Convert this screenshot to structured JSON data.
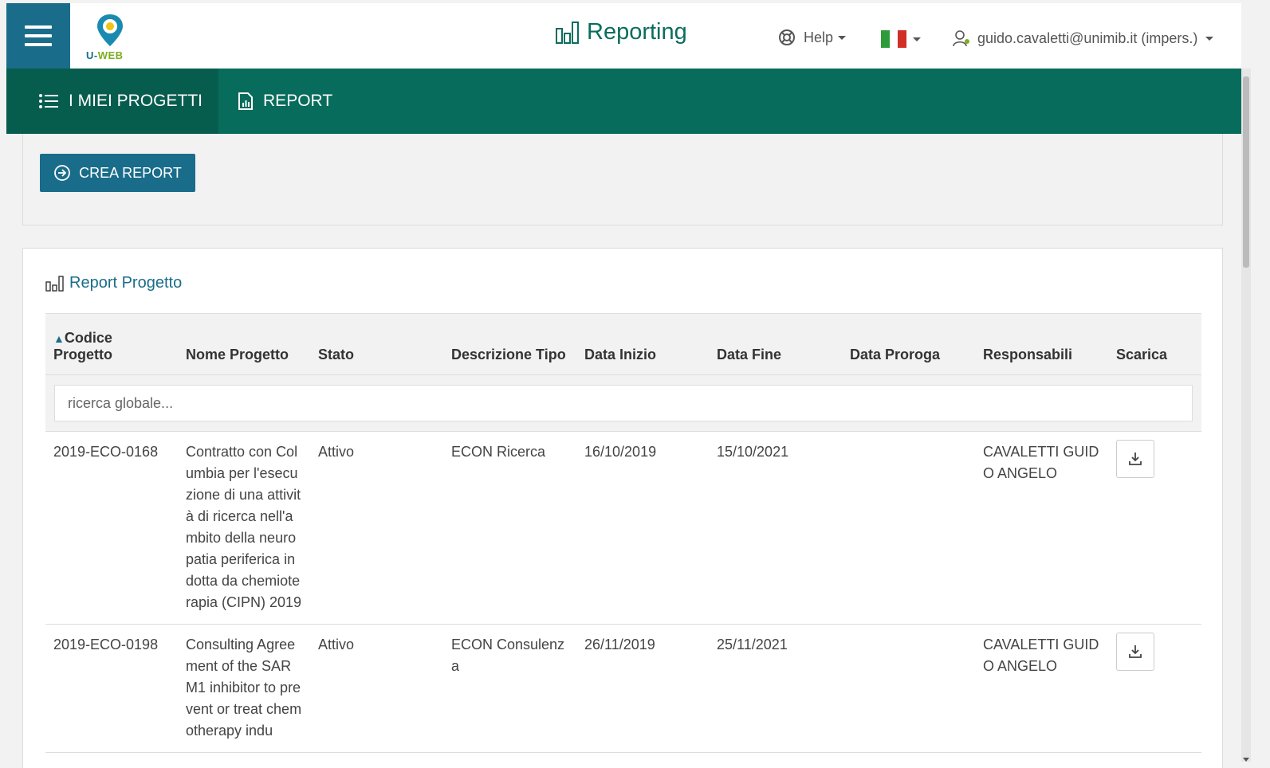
{
  "header": {
    "logo_text_u": "U-",
    "logo_text_web": "WEB",
    "app_title": "Reporting",
    "help_label": "Help",
    "user_label": "guido.cavaletti@unimib.it (impers.)",
    "flag_colors": [
      "#2d9b3a",
      "#ffffff",
      "#d22f27"
    ]
  },
  "nav": {
    "projects_label": "I MIEI PROGETTI",
    "report_label": "REPORT"
  },
  "actions": {
    "crea_report_label": "CREA REPORT"
  },
  "section": {
    "title": "Report Progetto"
  },
  "table": {
    "columns": [
      "Codice Progetto",
      "Nome Progetto",
      "Stato",
      "Descrizione Tipo",
      "Data Inizio",
      "Data Fine",
      "Data Proroga",
      "Responsabili",
      "Scarica"
    ],
    "sort_indicator": "▲",
    "search_placeholder": "ricerca globale...",
    "rows": [
      {
        "codice": "2019-ECO-0168",
        "nome": "Contratto con Columbia per l'esecuzione di una attività di ricerca nell'ambito della neuropatia periferica indotta da chemioterapia (CIPN) 2019",
        "stato": "Attivo",
        "tipo": "ECON Ricerca",
        "inizio": "16/10/2019",
        "fine": "15/10/2021",
        "proroga": "",
        "responsabili": "CAVALETTI GUIDO ANGELO"
      },
      {
        "codice": "2019-ECO-0198",
        "nome": "Consulting Agreement of the SARM1 inhibitor to prevent or treat chemotherapy indu",
        "stato": "Attivo",
        "tipo": "ECON Consulenza",
        "inizio": "26/11/2019",
        "fine": "25/11/2021",
        "proroga": "",
        "responsabili": "CAVALETTI GUIDO ANGELO"
      }
    ]
  },
  "colors": {
    "primary": "#1a6d8a",
    "nav_green": "#076c5b",
    "title_green": "#0a6d5e"
  }
}
